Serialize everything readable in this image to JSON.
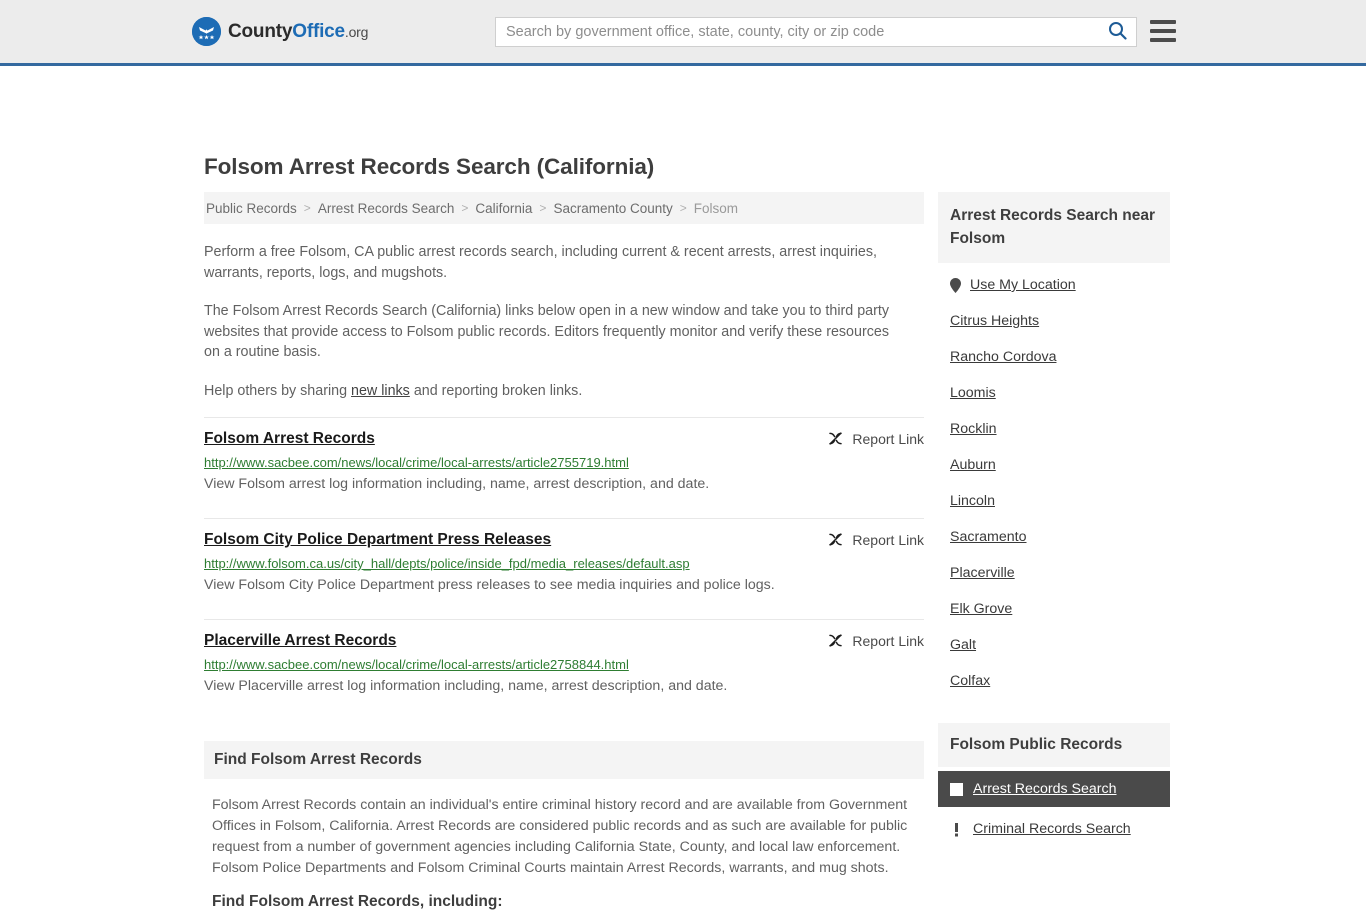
{
  "header": {
    "logo": {
      "word1": "County",
      "word2": "Office",
      "suffix": ".org",
      "icon": "eagle-seal-icon"
    },
    "search": {
      "placeholder": "Search by government office, state, county, city or zip code",
      "value": "",
      "icon": "search-icon"
    },
    "menu_icon": "hamburger-menu-icon"
  },
  "main": {
    "title": "Folsom Arrest Records Search (California)",
    "breadcrumb": [
      "Public Records",
      "Arrest Records Search",
      "California",
      "Sacramento County",
      "Folsom"
    ],
    "breadcrumb_separator": ">",
    "intro_1": "Perform a free Folsom, CA public arrest records search, including current & recent arrests, arrest inquiries, warrants, reports, logs, and mugshots.",
    "intro_2": "The Folsom Arrest Records Search (California) links below open in a new window and take you to third party websites that provide access to Folsom public records. Editors frequently monitor and verify these resources on a routine basis.",
    "intro_3_pre": "Help others by sharing ",
    "intro_3_link": "new links",
    "intro_3_post": " and reporting broken links.",
    "report_link_label": "Report Link",
    "report_link_icon": "broken-chain-icon",
    "results": [
      {
        "title": "Folsom Arrest Records",
        "url": "http://www.sacbee.com/news/local/crime/local-arrests/article2755719.html",
        "description": "View Folsom arrest log information including, name, arrest description, and date."
      },
      {
        "title": "Folsom City Police Department Press Releases",
        "url": "http://www.folsom.ca.us/city_hall/depts/police/inside_fpd/media_releases/default.asp",
        "description": "View Folsom City Police Department press releases to see media inquiries and police logs."
      },
      {
        "title": "Placerville Arrest Records",
        "url": "http://www.sacbee.com/news/local/crime/local-arrests/article2758844.html",
        "description": "View Placerville arrest log information including, name, arrest description, and date."
      }
    ],
    "find_section": {
      "heading": "Find Folsom Arrest Records",
      "body": "Folsom Arrest Records contain an individual's entire criminal history record and are available from Government Offices in Folsom, California. Arrest Records are considered public records and as such are available for public request from a number of government agencies including California State, County, and local law enforcement. Folsom Police Departments and Folsom Criminal Courts maintain Arrest Records, warrants, and mug shots.",
      "subheading": "Find Folsom Arrest Records, including:"
    }
  },
  "sidebar": {
    "nearby": {
      "heading": "Arrest Records Search near Folsom",
      "use_my_location": "Use My Location",
      "location_icon": "map-pin-icon",
      "cities": [
        "Citrus Heights",
        "Rancho Cordova",
        "Loomis",
        "Rocklin",
        "Auburn",
        "Lincoln",
        "Sacramento",
        "Placerville",
        "Elk Grove",
        "Galt",
        "Colfax"
      ]
    },
    "public_records": {
      "heading": "Folsom Public Records",
      "items": [
        {
          "label": "Arrest Records Search",
          "icon": "document-icon",
          "active": true
        },
        {
          "label": "Criminal Records Search",
          "icon": "exclamation-icon",
          "active": false
        }
      ]
    }
  },
  "colors": {
    "brand_blue": "#1d6cb5",
    "header_border": "#34699f",
    "header_bg": "#ececec",
    "panel_bg": "#f4f4f4",
    "url_green": "#2e7d32",
    "active_bg": "#4a4a4a",
    "text": "#616161"
  }
}
